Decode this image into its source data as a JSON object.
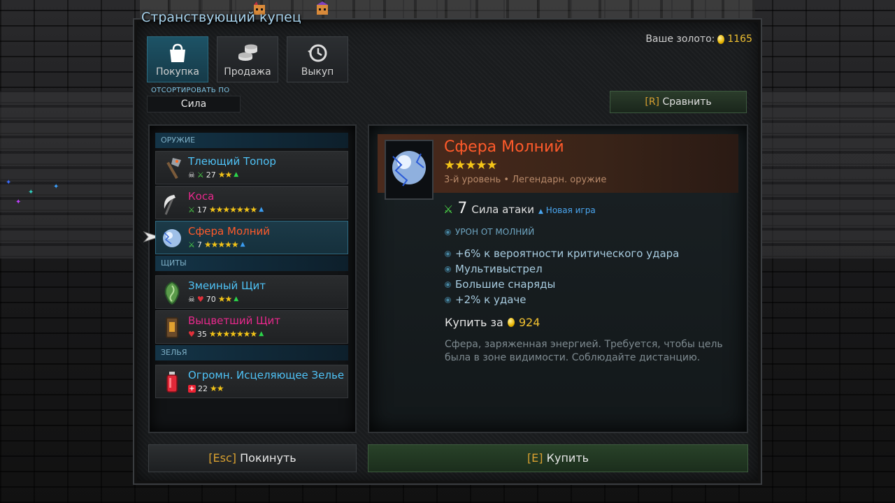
{
  "window": {
    "title": "Странствующий купец"
  },
  "gold": {
    "label": "Ваше золото:",
    "value": "1165"
  },
  "tabs": [
    {
      "label": "Покупка",
      "icon": "shopping-bag-icon",
      "active": true
    },
    {
      "label": "Продажа",
      "icon": "coin-stack-icon",
      "active": false
    },
    {
      "label": "Выкуп",
      "icon": "history-icon",
      "active": false
    }
  ],
  "sort": {
    "label": "ОТСОРТИРОВАТЬ ПО",
    "value": "Сила"
  },
  "compare": {
    "key": "[R]",
    "label": "Сравнить"
  },
  "categories": {
    "weapons": "ОРУЖИЕ",
    "shields": "ЩИТЫ",
    "potions": "ЗЕЛЬЯ"
  },
  "items": [
    {
      "name": "Тлеющий Топор",
      "stat": "27",
      "stars": "★★",
      "color": "#4fc3f7",
      "icon": "axe-icon"
    },
    {
      "name": "Коса",
      "stat": "17",
      "stars": "★★★★★★★",
      "color": "#e8288c",
      "icon": "scythe-icon"
    },
    {
      "name": "Сфера Молний",
      "stat": "7",
      "stars": "★★★★★",
      "color": "#ff5a2a",
      "icon": "lightning-orb-icon"
    },
    {
      "name": "Змеиный Щит",
      "stat": "70",
      "stars": "★★",
      "color": "#4fc3f7",
      "icon": "snake-shield-icon"
    },
    {
      "name": "Выцветший Щит",
      "stat": "35",
      "stars": "★★★★★★★",
      "color": "#e8288c",
      "icon": "faded-shield-icon"
    },
    {
      "name": "Огромн. Исцеляющее Зелье",
      "stat": "22",
      "stars": "★★",
      "color": "#4fc3f7",
      "icon": "health-potion-icon"
    }
  ],
  "detail": {
    "name": "Сфера Молний",
    "stars": "★★★★★",
    "subtitle": "3-й уровень • Легендарн. оружие",
    "attack_value": "7",
    "attack_label": "Сила атаки",
    "new_game": "Новая игра",
    "damage_type": "УРОН ОТ МОЛНИЙ",
    "attributes": [
      "+6% к вероятности критического удара",
      "Мультивыстрел",
      "Большие снаряды",
      "+2% к удаче"
    ],
    "price_label": "Купить за",
    "price": "924",
    "description": "Сфера, заряженная энергией. Требуется, чтобы цель была в зоне видимости. Соблюдайте дистанцию."
  },
  "buttons": {
    "leave_key": "[Esc]",
    "leave_label": "Покинуть",
    "buy_key": "[E]",
    "buy_label": "Купить"
  }
}
